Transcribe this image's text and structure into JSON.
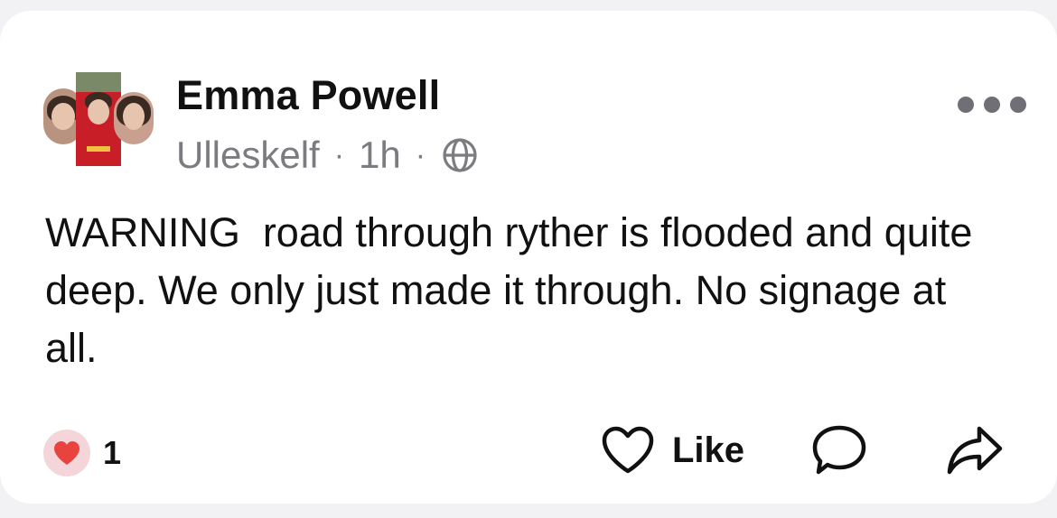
{
  "post": {
    "author": "Emma Powell",
    "location": "Ulleskelf",
    "separator": "·",
    "time": "1h",
    "audience_icon": "globe-icon",
    "text": "WARNING  road through ryther is flooded and quite deep. We only just made it through. No signage at all.",
    "reaction_icon": "heart-icon",
    "reaction_count": "1",
    "like_label": "Like"
  },
  "icons": {
    "more": "more-dots-icon",
    "like": "heart-outline-icon",
    "comment": "comment-bubble-icon",
    "share": "share-arrow-icon"
  },
  "colors": {
    "background": "#f2f2f4",
    "card": "#ffffff",
    "text": "#111111",
    "secondary_text": "#7b7b80",
    "heart": "#e8433f",
    "heart_badge_bg": "#f4d6da"
  }
}
